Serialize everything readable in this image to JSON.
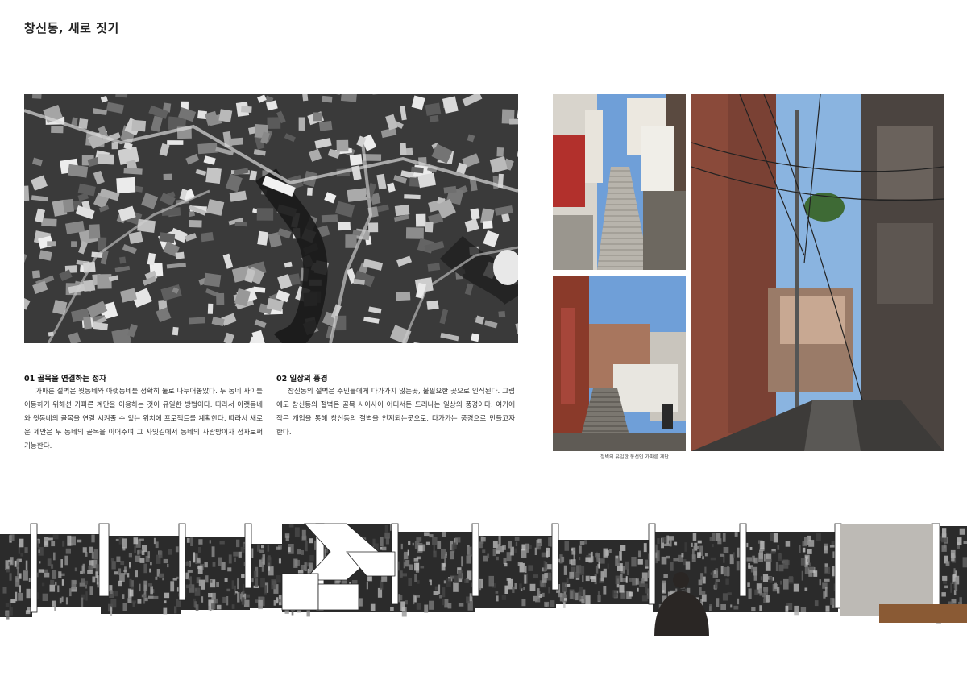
{
  "page": {
    "title": "창신동, 새로 짓기"
  },
  "sections": [
    {
      "heading": "01 골목을 연결하는 정자",
      "body": "가파른 절벽은 윗동네와 아랫동네를 정확히 둘로 나누어놓았다. 두 동네 사이를 이동하기 위해선 가파른 계단을 이용하는 것이 유일한 방법이다. 따라서 아랫동네와 윗동네의 골목을 연결 시켜줄 수 있는 위치에 프로젝트를 계획한다. 따라서 새로운 제안은 두 동네의 골목을 이어주며 그 사잇길에서 동네의 사랑방이자 정자로써 기능한다."
    },
    {
      "heading": "02 일상의 풍경",
      "body": "창신동의 절벽은 주민들에게 다가가지 않는곳, 불필요한 곳으로 인식된다. 그럼에도 창신동의 절벽은 골목 사이사이 어디서든 드러나는 일상의 풍경이다. 여기에 작은 개입을 통해 창신동의 절벽을 인지되는곳으로, 다가가는 풍경으로 만들고자 한다."
    }
  ],
  "photos": {
    "caption": "절벽의 유일한 동선인 가파른 계단"
  },
  "colors": {
    "sky": "#6f9fd8",
    "brick": "#8a4a3a",
    "red_wall": "#b2302c",
    "concrete": "#b9b5ad",
    "wood": "#8a5a34"
  }
}
